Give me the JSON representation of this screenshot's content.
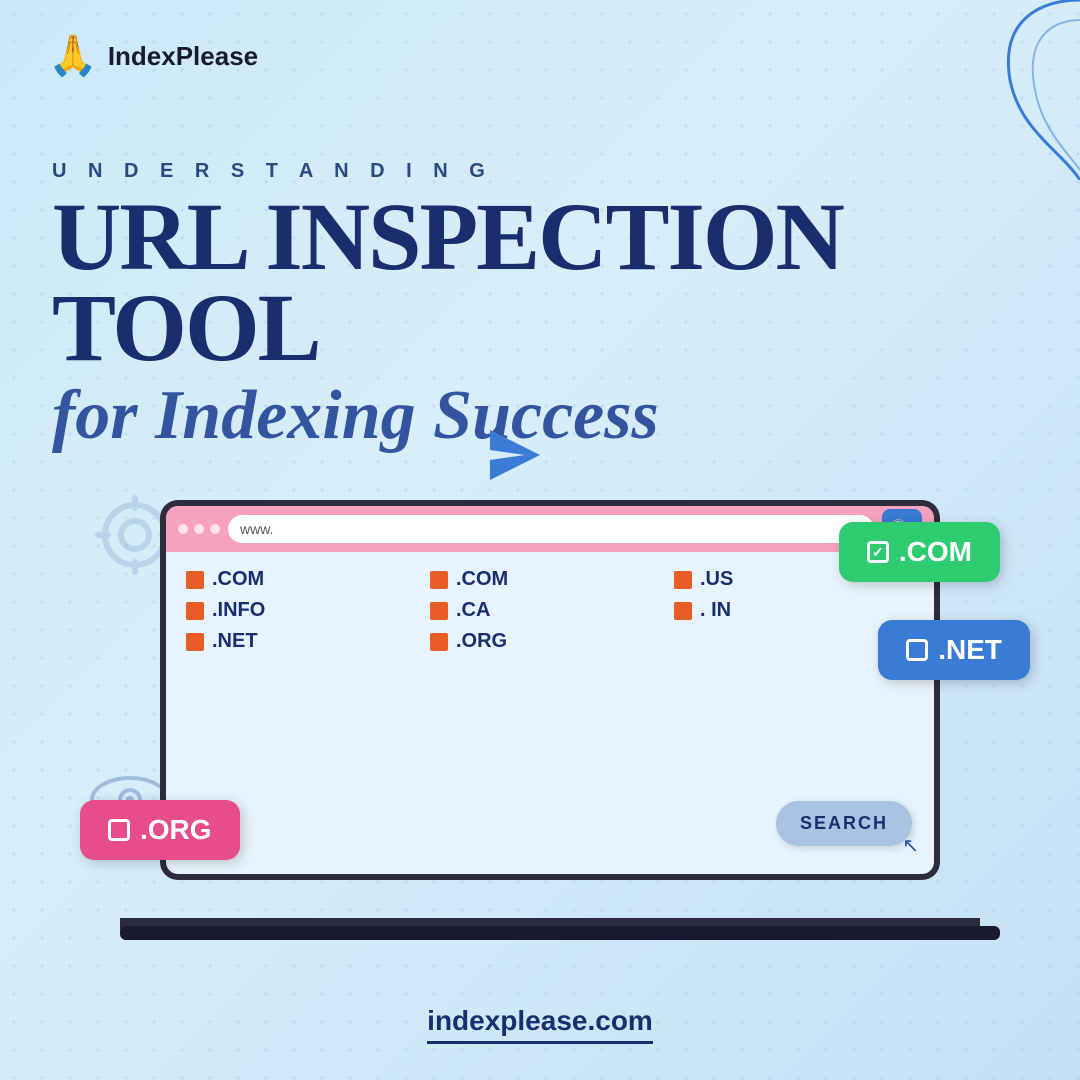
{
  "logo": {
    "emoji": "🙏",
    "text": "IndexPlease"
  },
  "header": {
    "subtitle": "U N D E R S T A N D I N G",
    "title_line1": "URL INSPECTION TOOL",
    "title_line2": "for Indexing Success"
  },
  "browser": {
    "dots": [
      "",
      "",
      ""
    ],
    "url_placeholder": "www.",
    "search_icon": "🔍"
  },
  "domains": [
    {
      "label": ".COM"
    },
    {
      "label": ".COM"
    },
    {
      "label": ".US"
    },
    {
      "label": ".INFO"
    },
    {
      "label": ".CA"
    },
    {
      "label": ". IN"
    },
    {
      "label": ".NET"
    },
    {
      "label": ".ORG"
    }
  ],
  "search_button": {
    "label": "SEARCH"
  },
  "badges": {
    "com": {
      "label": ".COM",
      "checked": true
    },
    "net": {
      "label": ".NET",
      "checked": false
    },
    "org": {
      "label": ".ORG",
      "checked": false
    }
  },
  "footer": {
    "url": "indexplease.com"
  }
}
